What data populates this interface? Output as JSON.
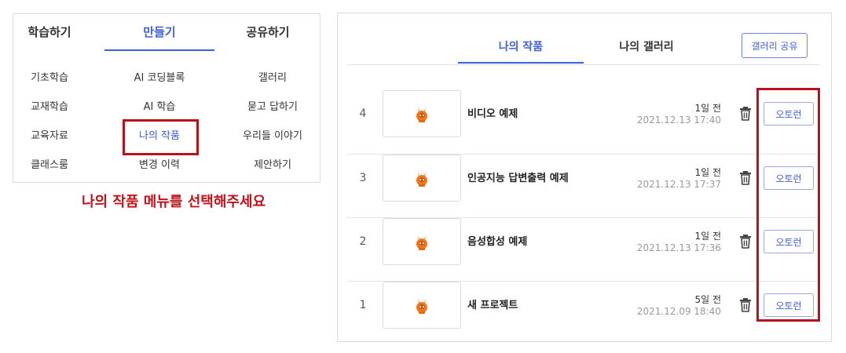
{
  "menu": {
    "tabs": [
      "학습하기",
      "만들기",
      "공유하기"
    ],
    "columns": [
      [
        "기초학습",
        "교재학습",
        "교육자료",
        "클래스룸"
      ],
      [
        "AI 코딩블록",
        "AI 학습",
        "나의 작품",
        "변경 이력"
      ],
      [
        "갤러리",
        "묻고 답하기",
        "우리들 이야기",
        "제안하기"
      ]
    ],
    "active_tab": "만들기",
    "active_item": "나의 작품"
  },
  "instruction": "나의 작품 메뉴를 선택해주세요",
  "works": {
    "tabs": [
      "나의 작품",
      "나의 갤러리"
    ],
    "share_label": "갤러리 공유",
    "projects": [
      {
        "num": "4",
        "title": "비디오 예제",
        "ago": "1일 전",
        "date": "2021.12.13 17:40",
        "button": "오토런"
      },
      {
        "num": "3",
        "title": "인공지능 답변출력 예제",
        "ago": "1일 전",
        "date": "2021.12.13 17:37",
        "button": "오토런"
      },
      {
        "num": "2",
        "title": "음성합성 예제",
        "ago": "1일 전",
        "date": "2021.12.13 17:36",
        "button": "오토런"
      },
      {
        "num": "1",
        "title": "새 프로젝트",
        "ago": "5일 전",
        "date": "2021.12.09 18:40",
        "button": "오토런"
      }
    ]
  },
  "colors": {
    "accent": "#3f5fd8",
    "highlight": "#b5121b",
    "mascot": "#f07a1a"
  },
  "icons": {
    "thumbnail": "mascot-icon",
    "delete": "trash-icon"
  }
}
